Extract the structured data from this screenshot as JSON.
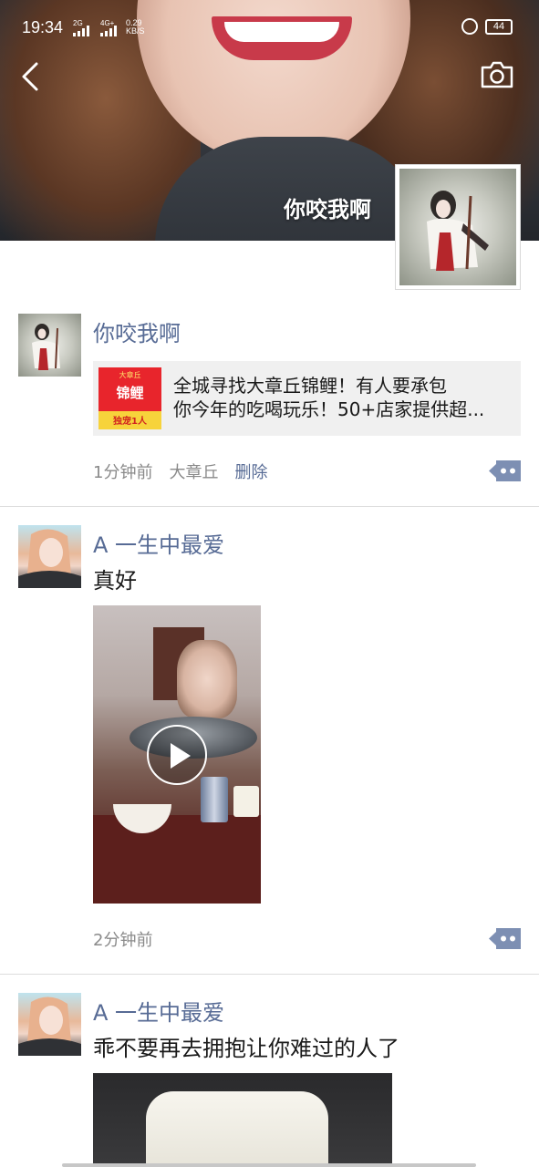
{
  "status_bar": {
    "time": "19:34",
    "signal_1_type": "2G",
    "signal_2_type": "4G+",
    "net_speed_value": "0.29",
    "net_speed_unit": "KB/S",
    "battery": "44"
  },
  "header": {
    "cover_name": "你咬我啊",
    "back_icon": "chevron-left-icon",
    "camera_icon": "camera-icon"
  },
  "posts": [
    {
      "author": "你咬我啊",
      "link_card": {
        "thumb_top": "大章丘",
        "thumb_main": "锦鲤",
        "thumb_bottom": "独宠1人",
        "line1": "全城寻找大章丘锦鲤！有人要承包",
        "line2": "你今年的吃喝玩乐！50+店家提供超..."
      },
      "time": "1分钟前",
      "location": "大章丘",
      "delete": "删除"
    },
    {
      "author": "A 一生中最爱",
      "text": "真好",
      "media": "video",
      "time": "2分钟前"
    },
    {
      "author": "A 一生中最爱",
      "text": "乖不要再去拥抱让你难过的人了",
      "media": "photo"
    }
  ],
  "colors": {
    "name_blue": "#576b95",
    "meta_gray": "#8a8a8a",
    "divider": "#dcdcdc",
    "card_bg": "#f0f0f0"
  }
}
